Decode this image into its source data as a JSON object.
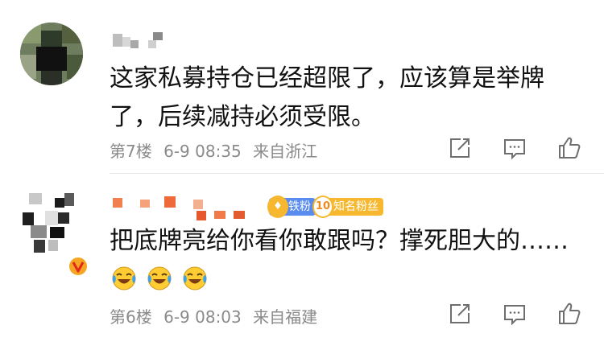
{
  "comments": [
    {
      "text_lines": [
        "这家私募持仓已经超限了，应该算是举牌",
        "了，后续减持必须受限。"
      ],
      "floor": "第7楼",
      "date": "6-9 08:35",
      "location": "来自浙江",
      "username_icon": "pixelated-username",
      "avatar_icon": "pixelated-avatar"
    },
    {
      "text_lines": [
        "把底牌亮给你看你敢跟吗？撑死胆大的……"
      ],
      "emoji": [
        "crying-laughing-face",
        "crying-laughing-face",
        "crying-laughing-face"
      ],
      "badges": [
        {
          "label": "铁粉",
          "icon": "iron-fan-badge",
          "color": "#5a8cf0"
        },
        {
          "label": "知名粉丝",
          "icon_text": "10",
          "color": "#f7b82f"
        }
      ],
      "floor": "第6楼",
      "date": "6-9 08:03",
      "location": "来自福建",
      "verified_icon": "v-verified-badge",
      "username_icon": "pixelated-orange-username",
      "avatar_icon": "pixelated-avatar"
    }
  ],
  "actions": [
    "share-icon",
    "comment-icon",
    "like-icon"
  ]
}
